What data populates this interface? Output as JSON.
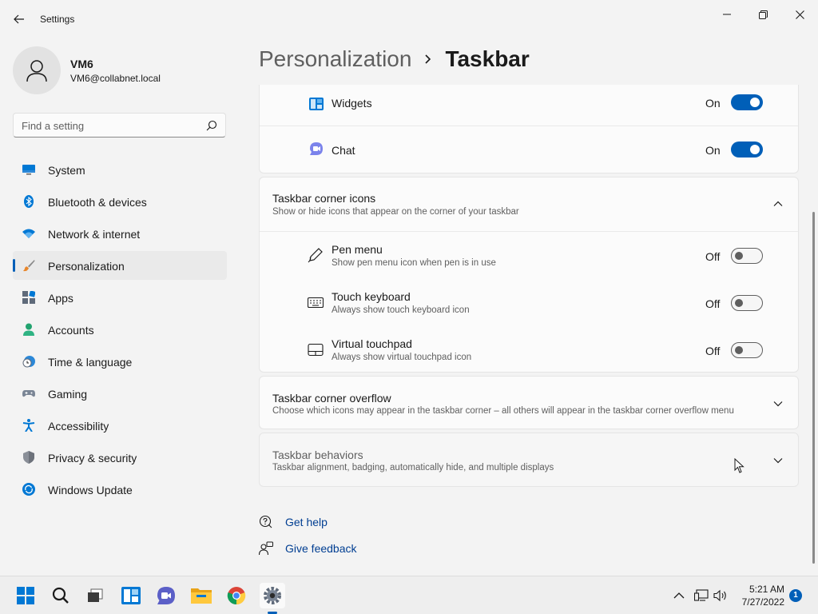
{
  "window": {
    "title": "Settings"
  },
  "user": {
    "name": "VM6",
    "email": "VM6@collabnet.local"
  },
  "search": {
    "placeholder": "Find a setting"
  },
  "sidebar": {
    "items": [
      {
        "label": "System",
        "icon": "monitor-icon"
      },
      {
        "label": "Bluetooth & devices",
        "icon": "bluetooth-icon"
      },
      {
        "label": "Network & internet",
        "icon": "wifi-icon"
      },
      {
        "label": "Personalization",
        "icon": "paintbrush-icon",
        "selected": true
      },
      {
        "label": "Apps",
        "icon": "apps-icon"
      },
      {
        "label": "Accounts",
        "icon": "person-icon"
      },
      {
        "label": "Time & language",
        "icon": "clock-globe-icon"
      },
      {
        "label": "Gaming",
        "icon": "gamepad-icon"
      },
      {
        "label": "Accessibility",
        "icon": "accessibility-icon"
      },
      {
        "label": "Privacy & security",
        "icon": "shield-icon"
      },
      {
        "label": "Windows Update",
        "icon": "update-icon"
      }
    ]
  },
  "breadcrumb": {
    "parent": "Personalization",
    "current": "Taskbar"
  },
  "taskbar_items_card": {
    "rows": [
      {
        "title": "Widgets",
        "state": "On",
        "on": true,
        "icon": "widgets-icon"
      },
      {
        "title": "Chat",
        "state": "On",
        "on": true,
        "icon": "chat-icon"
      }
    ]
  },
  "corner_icons": {
    "title": "Taskbar corner icons",
    "subtitle": "Show or hide icons that appear on the corner of your taskbar",
    "expanded": true,
    "rows": [
      {
        "title": "Pen menu",
        "subtitle": "Show pen menu icon when pen is in use",
        "state": "Off",
        "on": false,
        "icon": "pen-icon"
      },
      {
        "title": "Touch keyboard",
        "subtitle": "Always show touch keyboard icon",
        "state": "Off",
        "on": false,
        "icon": "keyboard-icon"
      },
      {
        "title": "Virtual touchpad",
        "subtitle": "Always show virtual touchpad icon",
        "state": "Off",
        "on": false,
        "icon": "touchpad-icon"
      }
    ]
  },
  "corner_overflow": {
    "title": "Taskbar corner overflow",
    "subtitle": "Choose which icons may appear in the taskbar corner – all others will appear in the taskbar corner overflow menu",
    "expanded": false
  },
  "behaviors": {
    "title": "Taskbar behaviors",
    "subtitle": "Taskbar alignment, badging, automatically hide, and multiple displays",
    "expanded": false
  },
  "links": {
    "help": "Get help",
    "feedback": "Give feedback"
  },
  "system_taskbar": {
    "apps": [
      "start-icon",
      "search-icon",
      "task-view-icon",
      "widgets-icon",
      "chat-icon",
      "file-explorer-icon",
      "chrome-icon",
      "settings-icon"
    ],
    "active_app": "settings-icon",
    "clock": {
      "time": "5:21 AM",
      "date": "7/27/2022"
    },
    "notification_count": "1"
  },
  "colors": {
    "accent": "#005fb8",
    "link": "#003e92",
    "background": "#f3f3f3",
    "card": "#fbfbfb"
  }
}
